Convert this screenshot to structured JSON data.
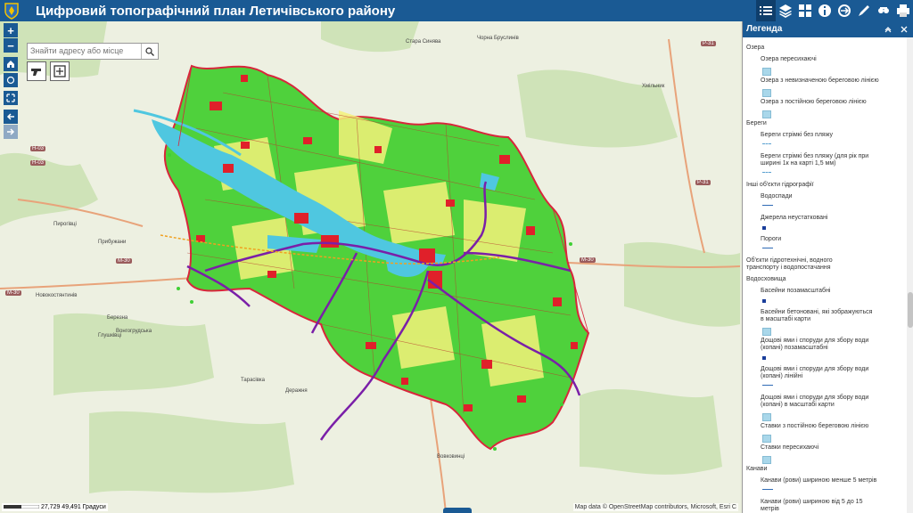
{
  "header": {
    "title": "Цифровий топографічний план Летичівського району"
  },
  "toolbar": {
    "icons": [
      "list-icon",
      "layers-icon",
      "basemap-icon",
      "info-icon",
      "swipe-icon",
      "draw-icon",
      "measure-icon",
      "print-icon"
    ]
  },
  "search": {
    "placeholder": "Знайти адресу або місце"
  },
  "map_controls": {
    "zoom_in": "+",
    "zoom_out": "−"
  },
  "map": {
    "scale_text": "27,729 49,491 Градуси",
    "attribution": "Map data © OpenStreetMap contributors, Microsoft, Esri C",
    "labels": [
      "Стара Синява",
      "Хмільник",
      "Чорна Бруслинів",
      "Пирогівці",
      "Прибужани",
      "Березна",
      "Вонгогрудська",
      "Тарасівка",
      "Деражня",
      "Вовковинці",
      "Новокостянтинів",
      "Глушківці"
    ],
    "road_labels": [
      "Н-03",
      "Р-31",
      "М-30",
      "М-30",
      "Р-31",
      "М-30",
      "Н-03"
    ]
  },
  "legend": {
    "title": "Легенда",
    "items": [
      {
        "text": "Озера",
        "sym": "none",
        "type": "group"
      },
      {
        "text": "Озера пересихаючі",
        "sym": "box",
        "type": "item"
      },
      {
        "text": "Озера з невизначеною береговою лінією",
        "sym": "box",
        "type": "item"
      },
      {
        "text": "Озера з постійною береговою лінією",
        "sym": "box",
        "type": "item"
      },
      {
        "text": "Береги",
        "sym": "none",
        "type": "group"
      },
      {
        "text": "Береги стрімкі без пляжу",
        "sym": "dash",
        "type": "item"
      },
      {
        "text": "Береги стрімкі без пляжу (для рік при ширині 1к на карті 1,5 мм)",
        "sym": "dash",
        "type": "item"
      },
      {
        "text": "Інші об'єкти гідрографії",
        "sym": "none",
        "type": "group"
      },
      {
        "text": "Водоспади",
        "sym": "line",
        "type": "item"
      },
      {
        "text": "Джерела неустатковані",
        "sym": "dot",
        "type": "item"
      },
      {
        "text": "Пороги",
        "sym": "line",
        "type": "item"
      },
      {
        "text": "Об'єкти гідротехнічні, водного транспорту і водопостачання",
        "sym": "none",
        "type": "group"
      },
      {
        "text": "Водосховища",
        "sym": "none",
        "type": "group"
      },
      {
        "text": "Басейни позамасштабні",
        "sym": "dot",
        "type": "item"
      },
      {
        "text": "Басейни бетоновані, які зображуються в масштабі карти",
        "sym": "box",
        "type": "item"
      },
      {
        "text": "Дощові ями і споруди для збору води (копані) позамасштабні",
        "sym": "dot",
        "type": "item"
      },
      {
        "text": "Дощові ями і споруди для збору води (копані) лінійні",
        "sym": "line",
        "type": "item"
      },
      {
        "text": "Дощові ями і споруди для збору води (копані) в масштабі карти",
        "sym": "box",
        "type": "item"
      },
      {
        "text": "Ставки з постійною береговою лінією",
        "sym": "box",
        "type": "item"
      },
      {
        "text": "Ставки пересихаючі",
        "sym": "box",
        "type": "item"
      },
      {
        "text": "Канави",
        "sym": "none",
        "type": "group"
      },
      {
        "text": "Канави (рови) шириною менше 5 метрів",
        "sym": "line",
        "type": "item"
      },
      {
        "text": "Канави (рови) шириною від 5 до 15 метрів",
        "sym": "line",
        "type": "item"
      }
    ]
  },
  "colors": {
    "header": "#1a5a94",
    "boundary": "#d8263b",
    "vegetation": "#3fd035",
    "water": "#4fc7e0",
    "settlement": "#e0202a",
    "road": "#7a1fa8"
  }
}
